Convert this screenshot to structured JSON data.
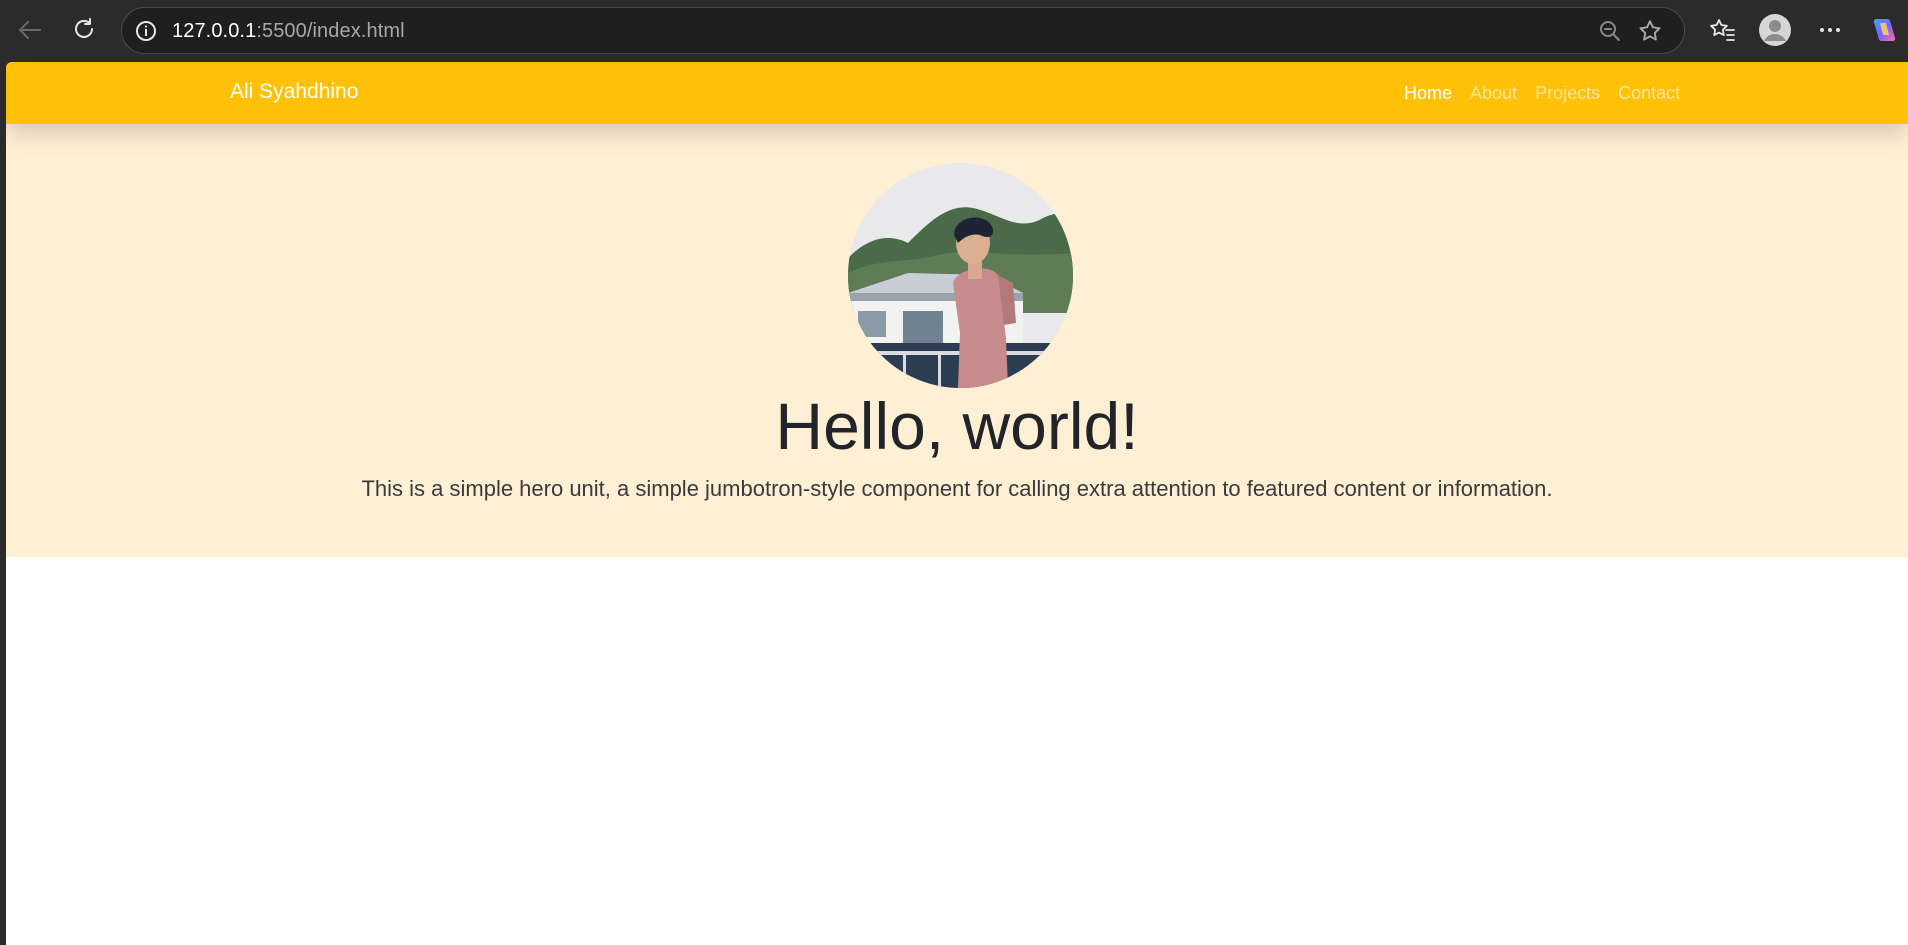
{
  "browser": {
    "url_host": "127.0.0.1",
    "url_path": ":5500/index.html",
    "icons": [
      "back-arrow-icon",
      "refresh-icon",
      "site-info-icon",
      "zoom-out-icon",
      "favorite-star-icon",
      "favorites-list-icon",
      "profile-avatar-icon",
      "more-menu-icon",
      "copilot-icon"
    ]
  },
  "navbar": {
    "brand": "Ali Syahdhino",
    "links": [
      {
        "label": "Home",
        "active": true
      },
      {
        "label": "About",
        "active": false
      },
      {
        "label": "Projects",
        "active": false
      },
      {
        "label": "Contact",
        "active": false
      }
    ],
    "background": "#ffc107"
  },
  "hero": {
    "title": "Hello, world!",
    "lead": "This is a simple hero unit, a simple jumbotron-style component for calling extra attention to featured content or information.",
    "background": "#fff0d5",
    "avatar_icon": "profile-photo"
  }
}
